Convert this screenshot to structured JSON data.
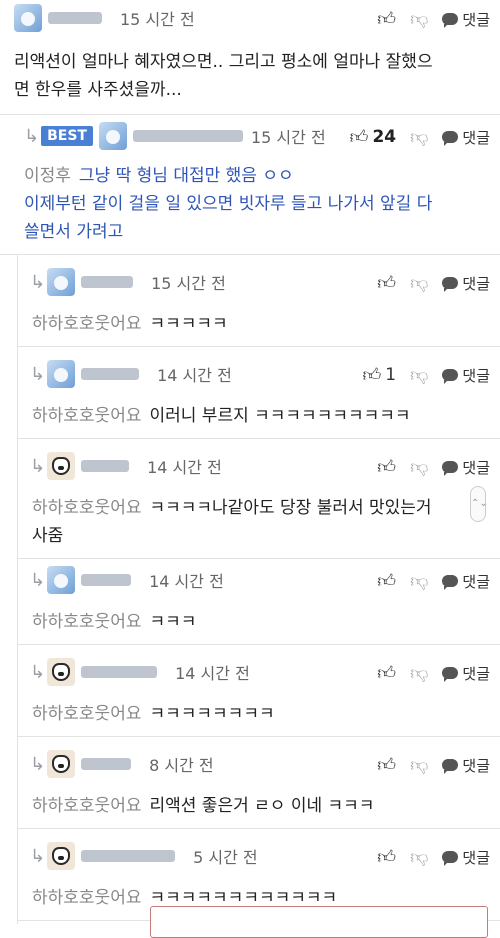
{
  "reply_label": "댓글",
  "main_comment": {
    "time": "15 시간 전",
    "text_line1": "리액션이 얼마나 혜자였으면.. 그리고 평소에 얼마나 잘했으",
    "text_line2": "면 한우를 사주셨을까..."
  },
  "best_reply": {
    "badge": "BEST",
    "time": "15 시간 전",
    "like_count": "24",
    "mention": "이정후",
    "text_line1": "그냥 딱 형님 대접만 했음 ㅇㅇ",
    "text_line2": "이제부턴 같이 걸을 일 있으면 빗자루 들고 나가서 앞길 다",
    "text_line3": "쓸면서 가려고"
  },
  "replies": [
    {
      "time": "15 시간 전",
      "mention": "하하호호웃어요",
      "text": "ㅋㅋㅋㅋㅋ",
      "like_count": ""
    },
    {
      "time": "14 시간 전",
      "mention": "하하호호웃어요",
      "text": "이러니 부르지 ㅋㅋㅋㅋㅋㅋㅋㅋㅋㅋ",
      "like_count": "1"
    },
    {
      "time": "14 시간 전",
      "mention": "하하호호웃어요",
      "text": "ㅋㅋㅋㅋ나같아도 당장 불러서 맛있는거",
      "text2": "사줌",
      "like_count": ""
    },
    {
      "time": "14 시간 전",
      "mention": "하하호호웃어요",
      "text": "ㅋㅋㅋ",
      "like_count": ""
    },
    {
      "time": "14 시간 전",
      "mention": "하하호호웃어요",
      "text": "ㅋㅋㅋㅋㅋㅋㅋㅋ",
      "like_count": ""
    },
    {
      "time": "8 시간 전",
      "mention": "하하호호웃어요",
      "text": "리액션 좋은거 ㄹㅇ 이네 ㅋㅋㅋ",
      "like_count": ""
    },
    {
      "time": "5 시간 전",
      "mention": "하하호호웃어요",
      "text": "ㅋㅋㅋㅋㅋㅋㅋㅋㅋㅋㅋㅋ",
      "like_count": ""
    }
  ]
}
